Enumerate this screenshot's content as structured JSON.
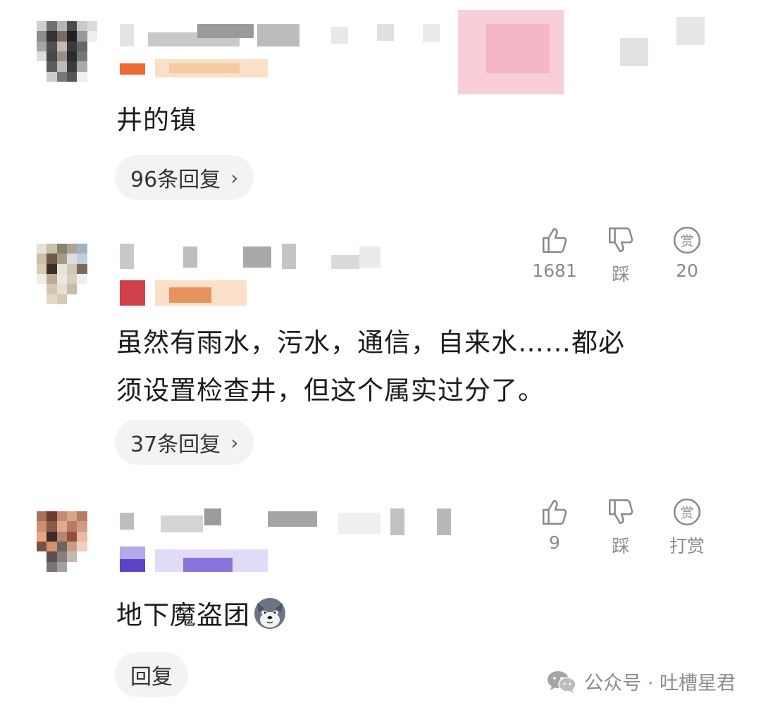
{
  "comments": [
    {
      "text": "井的镇",
      "reply_label": "96条回复",
      "chevron": "›"
    },
    {
      "text_line1": "虽然有雨水，污水，通信，自来水……都必",
      "text_line2": "须设置检查井，但这个属实过分了。",
      "reply_label": "37条回复",
      "chevron": "›",
      "actions": {
        "like_count": "1681",
        "dislike_label": "踩",
        "reward_count": "20"
      }
    },
    {
      "text": "地下魔盗团",
      "emoji": "wolf-dog-emoji",
      "reply_label": "回复",
      "actions": {
        "like_count": "9",
        "dislike_label": "踩",
        "reward_label": "打赏"
      }
    }
  ],
  "icons": {
    "like": "thumbs-up-icon",
    "dislike": "thumbs-down-icon",
    "reward": "reward-coin-icon",
    "reward_glyph": "赏",
    "wechat": "wechat-icon"
  },
  "watermark": {
    "text": "公众号 · 吐槽星君"
  },
  "colors": {
    "pill_bg": "#f3f3f3",
    "muted": "#8a8a8a",
    "text": "#1b1b1b"
  }
}
